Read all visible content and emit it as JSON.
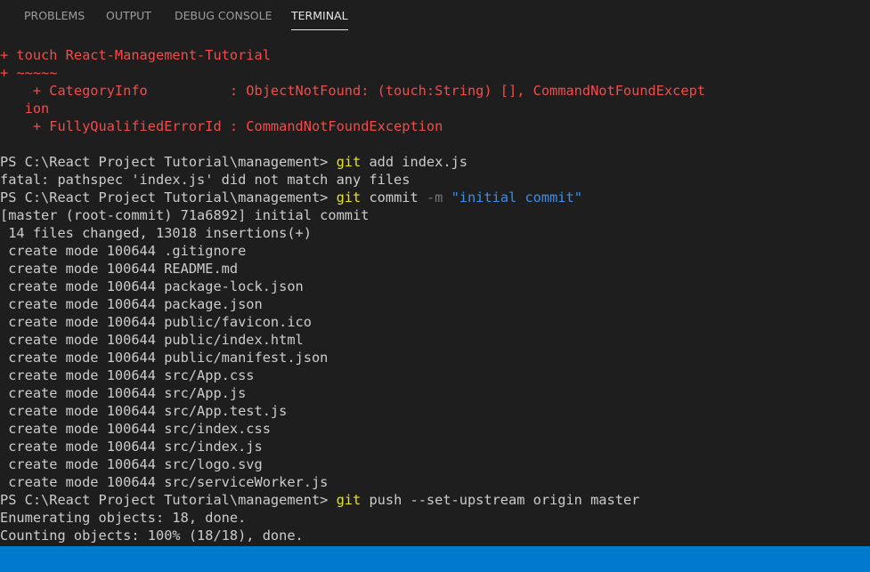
{
  "tabs": [
    {
      "label": "PROBLEMS"
    },
    {
      "label": "OUTPUT"
    },
    {
      "label": "DEBUG CONSOLE"
    },
    {
      "label": "TERMINAL"
    }
  ],
  "active_tab": "TERMINAL",
  "colors": {
    "background": "#1e1e1e",
    "error_text": "#f14c4c",
    "command_text": "#e5e510",
    "string_text": "#3b8eea",
    "flag_text": "#767676",
    "default_text": "#cccccc",
    "status_bar": "#007acc"
  },
  "terminal": {
    "error_lines": [
      "+ touch React-Management-Tutorial",
      "+ ~~~~~",
      "    + CategoryInfo          : ObjectNotFound: (touch:String) [], CommandNotFoundExcept",
      "   ion",
      "    + FullyQualifiedErrorId : CommandNotFoundException"
    ],
    "prompt": "PS C:\\React Project Tutorial\\management> ",
    "cmd1": {
      "cmd": "git",
      "rest": " add index.js"
    },
    "out1": "fatal: pathspec 'index.js' did not match any files",
    "cmd2": {
      "cmd": "git",
      "rest1": " commit ",
      "flag": "-m",
      "space": " ",
      "str": "\"initial commit\""
    },
    "commit_output": [
      "[master (root-commit) 71a6892] initial commit",
      " 14 files changed, 13018 insertions(+)",
      " create mode 100644 .gitignore",
      " create mode 100644 README.md",
      " create mode 100644 package-lock.json",
      " create mode 100644 package.json",
      " create mode 100644 public/favicon.ico",
      " create mode 100644 public/index.html",
      " create mode 100644 public/manifest.json",
      " create mode 100644 src/App.css",
      " create mode 100644 src/App.js",
      " create mode 100644 src/App.test.js",
      " create mode 100644 src/index.css",
      " create mode 100644 src/index.js",
      " create mode 100644 src/logo.svg",
      " create mode 100644 src/serviceWorker.js"
    ],
    "cmd3": {
      "cmd": "git",
      "rest": " push --set-upstream origin master"
    },
    "push_output": [
      "Enumerating objects: 18, done.",
      "Counting objects: 100% (18/18), done."
    ]
  }
}
